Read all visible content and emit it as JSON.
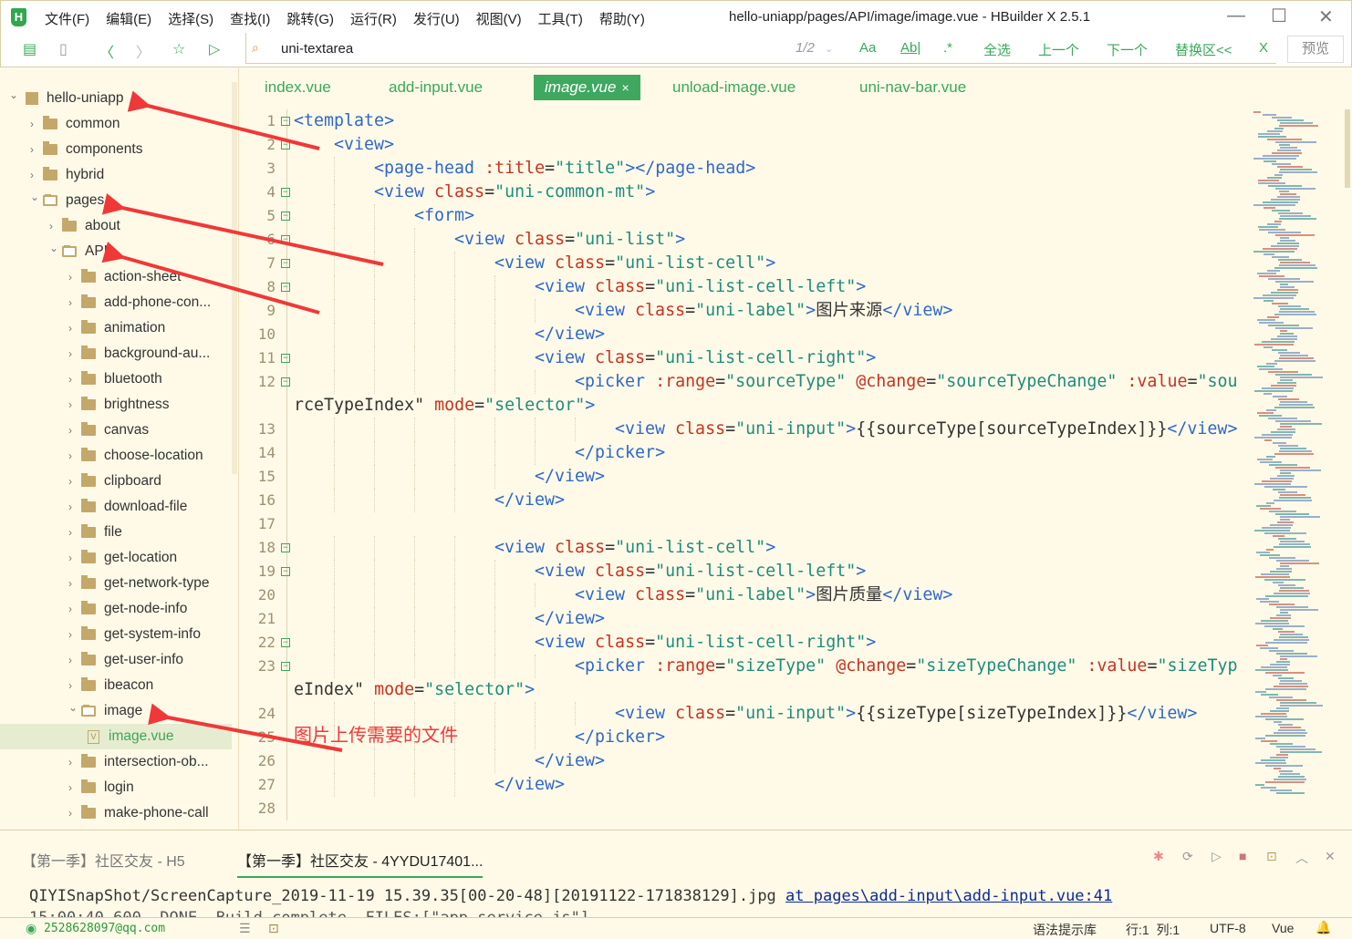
{
  "app": {
    "title": "hello-uniapp/pages/API/image/image.vue - HBuilder X 2.5.1",
    "logo": "H"
  },
  "menu": [
    "文件(F)",
    "编辑(E)",
    "选择(S)",
    "查找(I)",
    "跳转(G)",
    "运行(R)",
    "发行(U)",
    "视图(V)",
    "工具(T)",
    "帮助(Y)"
  ],
  "toolbar": {
    "icons": [
      "new-file-icon",
      "save-icon",
      "back-icon",
      "forward-icon",
      "star-icon",
      "run-icon"
    ],
    "search_value": "uni-textarea",
    "match_count": "1/2",
    "case_label": "Aa",
    "word_label": "Ab|",
    "regex_label": ".*",
    "select_all": "全选",
    "prev": "上一个",
    "next": "下一个",
    "replace": "替换区<<",
    "close": "X",
    "preview": "预览"
  },
  "tree": [
    {
      "label": "hello-uniapp",
      "depth": 0,
      "type": "project",
      "expanded": true
    },
    {
      "label": "common",
      "depth": 1,
      "type": "folder"
    },
    {
      "label": "components",
      "depth": 1,
      "type": "folder"
    },
    {
      "label": "hybrid",
      "depth": 1,
      "type": "folder"
    },
    {
      "label": "pages",
      "depth": 1,
      "type": "folder",
      "expanded": true
    },
    {
      "label": "about",
      "depth": 2,
      "type": "folder"
    },
    {
      "label": "API",
      "depth": 2,
      "type": "folder",
      "expanded": true
    },
    {
      "label": "action-sheet",
      "depth": 3,
      "type": "folder"
    },
    {
      "label": "add-phone-con...",
      "depth": 3,
      "type": "folder"
    },
    {
      "label": "animation",
      "depth": 3,
      "type": "folder"
    },
    {
      "label": "background-au...",
      "depth": 3,
      "type": "folder"
    },
    {
      "label": "bluetooth",
      "depth": 3,
      "type": "folder"
    },
    {
      "label": "brightness",
      "depth": 3,
      "type": "folder"
    },
    {
      "label": "canvas",
      "depth": 3,
      "type": "folder"
    },
    {
      "label": "choose-location",
      "depth": 3,
      "type": "folder"
    },
    {
      "label": "clipboard",
      "depth": 3,
      "type": "folder"
    },
    {
      "label": "download-file",
      "depth": 3,
      "type": "folder"
    },
    {
      "label": "file",
      "depth": 3,
      "type": "folder"
    },
    {
      "label": "get-location",
      "depth": 3,
      "type": "folder"
    },
    {
      "label": "get-network-type",
      "depth": 3,
      "type": "folder"
    },
    {
      "label": "get-node-info",
      "depth": 3,
      "type": "folder"
    },
    {
      "label": "get-system-info",
      "depth": 3,
      "type": "folder"
    },
    {
      "label": "get-user-info",
      "depth": 3,
      "type": "folder"
    },
    {
      "label": "ibeacon",
      "depth": 3,
      "type": "folder"
    },
    {
      "label": "image",
      "depth": 3,
      "type": "folder",
      "expanded": true
    },
    {
      "label": "image.vue",
      "depth": 4,
      "type": "file",
      "selected": true
    },
    {
      "label": "intersection-ob...",
      "depth": 3,
      "type": "folder"
    },
    {
      "label": "login",
      "depth": 3,
      "type": "folder"
    },
    {
      "label": "make-phone-call",
      "depth": 3,
      "type": "folder"
    }
  ],
  "tabs": [
    {
      "label": "index.vue"
    },
    {
      "label": "add-input.vue"
    },
    {
      "label": "image.vue",
      "active": true,
      "close": "×"
    },
    {
      "label": "unload-image.vue"
    },
    {
      "label": "uni-nav-bar.vue"
    }
  ],
  "code": [
    {
      "n": "1",
      "fold": true,
      "indent": 0,
      "text": "<template>"
    },
    {
      "n": "2",
      "fold": true,
      "indent": 1,
      "text": "<view>"
    },
    {
      "n": "3",
      "indent": 2,
      "text": "<page-head :title=\"title\"></page-head>"
    },
    {
      "n": "4",
      "fold": true,
      "indent": 2,
      "text": "<view class=\"uni-common-mt\">"
    },
    {
      "n": "5",
      "fold": true,
      "indent": 3,
      "text": "<form>"
    },
    {
      "n": "6",
      "fold": true,
      "indent": 4,
      "text": "<view class=\"uni-list\">"
    },
    {
      "n": "7",
      "fold": true,
      "indent": 5,
      "text": "<view class=\"uni-list-cell\">"
    },
    {
      "n": "8",
      "fold": true,
      "indent": 6,
      "text": "<view class=\"uni-list-cell-left\">"
    },
    {
      "n": "9",
      "indent": 7,
      "text": "<view class=\"uni-label\">图片来源</view>"
    },
    {
      "n": "10",
      "indent": 6,
      "text": "</view>"
    },
    {
      "n": "11",
      "fold": true,
      "indent": 6,
      "text": "<view class=\"uni-list-cell-right\">"
    },
    {
      "n": "12",
      "fold": true,
      "indent": 7,
      "text": "<picker :range=\"sourceType\" @change=\"sourceTypeChange\" :value=\"sou"
    },
    {
      "n": "",
      "indent": 0,
      "text": "rceTypeIndex\" mode=\"selector\">",
      "cont": true
    },
    {
      "n": "13",
      "indent": 8,
      "text": "<view class=\"uni-input\">{{sourceType[sourceTypeIndex]}}</view>"
    },
    {
      "n": "14",
      "indent": 7,
      "text": "</picker>"
    },
    {
      "n": "15",
      "indent": 6,
      "text": "</view>"
    },
    {
      "n": "16",
      "indent": 5,
      "text": "</view>"
    },
    {
      "n": "17",
      "indent": 0,
      "text": ""
    },
    {
      "n": "18",
      "fold": true,
      "indent": 5,
      "text": "<view class=\"uni-list-cell\">"
    },
    {
      "n": "19",
      "fold": true,
      "indent": 6,
      "text": "<view class=\"uni-list-cell-left\">"
    },
    {
      "n": "20",
      "indent": 7,
      "text": "<view class=\"uni-label\">图片质量</view>"
    },
    {
      "n": "21",
      "indent": 6,
      "text": "</view>"
    },
    {
      "n": "22",
      "fold": true,
      "indent": 6,
      "text": "<view class=\"uni-list-cell-right\">"
    },
    {
      "n": "23",
      "fold": true,
      "indent": 7,
      "text": "<picker :range=\"sizeType\" @change=\"sizeTypeChange\" :value=\"sizeTyp"
    },
    {
      "n": "",
      "indent": 0,
      "text": "eIndex\" mode=\"selector\">",
      "cont": true
    },
    {
      "n": "24",
      "indent": 8,
      "text": "<view class=\"uni-input\">{{sizeType[sizeTypeIndex]}}</view>"
    },
    {
      "n": "25",
      "indent": 7,
      "text": "</picker>"
    },
    {
      "n": "26",
      "indent": 6,
      "text": "</view>"
    },
    {
      "n": "27",
      "indent": 5,
      "text": "</view>"
    },
    {
      "n": "28",
      "indent": 0,
      "text": ""
    }
  ],
  "annotation": "图片上传需要的文件",
  "colors": {
    "accent": "#3aa85a",
    "tag": "#2f68c8",
    "attr": "#c8321e",
    "string": "#1e8c7c",
    "arrow": "#f03838"
  },
  "panel": {
    "tabs": [
      "【第一季】社区交友 - H5",
      "【第一季】社区交友 - 4YYDU17401..."
    ],
    "console_text": "QIYISnapShot/ScreenCapture_2019-11-19 15.39.35[00-20-48][20191122-171838129].jpg ",
    "console_link": "at pages\\add-input\\add-input.vue:41",
    "console_line2": "15:00:40.600  DONE  Build complete. FILES:[\"app-service.js\"]"
  },
  "status": {
    "user": "2528628097@qq.com",
    "syntax": "语法提示库",
    "position": "行:1  列:1",
    "encoding": "UTF-8",
    "language": "Vue"
  }
}
